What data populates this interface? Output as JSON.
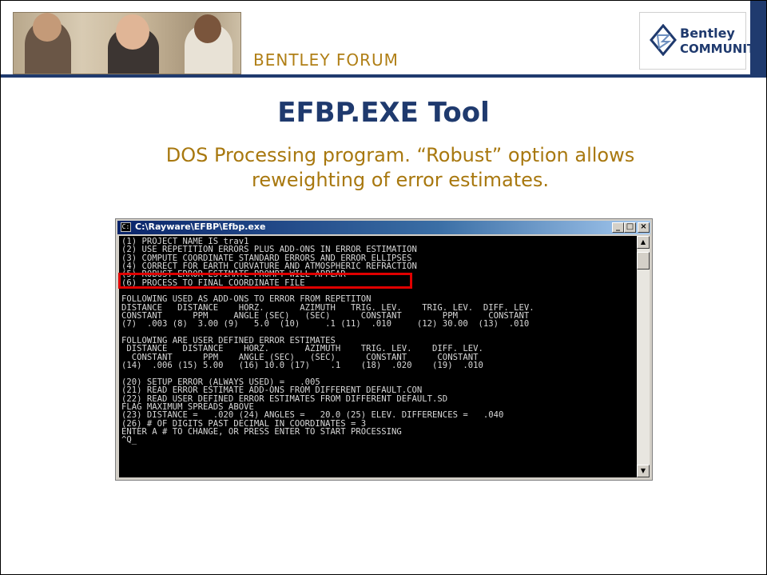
{
  "header": {
    "forum_label": "BENTLEY FORUM",
    "logo_line1": "Bentley",
    "logo_line2": "COMMUNITY",
    "accent_color": "#1f3a6e",
    "gold_color": "#b07f16"
  },
  "slide": {
    "title": "EFBP.EXE Tool",
    "subtitle": "DOS Processing program.  “Robust” option allows reweighting of error estimates."
  },
  "console": {
    "window_title": "C:\\Rayware\\EFBP\\Efbp.exe",
    "icon": "console-icon",
    "buttons": {
      "minimize": "_",
      "maximize": "□",
      "close": "×"
    },
    "lines": [
      "(1) PROJECT NAME IS trav1",
      "(2) USE REPETITION ERRORS PLUS ADD-ONS IN ERROR ESTIMATION",
      "(3) COMPUTE COORDINATE STANDARD ERRORS AND ERROR ELLIPSES",
      "(4) CORRECT FOR EARTH CURVATURE AND ATMOSPHERIC REFRACTION",
      "(5) ROBUST ERROR ESTIMATE PROMPT WILL APPEAR",
      "(6) PROCESS TO FINAL COORDINATE FILE",
      "",
      "FOLLOWING USED AS ADD-ONS TO ERROR FROM REPETITON",
      "DISTANCE   DISTANCE    HORZ.       AZIMUTH   TRIG. LEV.    TRIG. LEV.  DIFF. LEV.",
      "CONSTANT      PPM     ANGLE (SEC)   (SEC)      CONSTANT        PPM      CONSTANT",
      "(7)  .003 (8)  3.00 (9)   5.0  (10)     .1 (11)  .010     (12) 30.00  (13)  .010",
      "",
      "FOLLOWING ARE USER DEFINED ERROR ESTIMATES",
      " DISTANCE   DISTANCE    HORZ.       AZIMUTH    TRIG. LEV.    DIFF. LEV.",
      "  CONSTANT      PPM    ANGLE (SEC)   (SEC)      CONSTANT      CONSTANT",
      "(14)  .006 (15) 5.00   (16) 10.0 (17)    .1    (18)  .020    (19)  .010",
      "",
      "(20) SETUP ERROR (ALWAYS USED) =   .005",
      "(21) READ ERROR ESTIMATE ADD-ONS FROM DIFFERENT DEFAULT.CON",
      "(22) READ USER DEFINED ERROR ESTIMATES FROM DIFFERENT DEFAULT.SD",
      "FLAG MAXIMUM SPREADS ABOVE",
      "(23) DISTANCE =   .020 (24) ANGLES =   20.0 (25) ELEV. DIFFERENCES =   .040",
      "(26) # OF DIGITS PAST DECIMAL IN COORDINATES = 3",
      "ENTER A # TO CHANGE, OR PRESS ENTER TO START PROCESSING",
      "^Q_"
    ],
    "highlighted_line": "(5) ROBUST ERROR ESTIMATE PROMPT WILL APPEAR",
    "highlight_color": "#e00000"
  }
}
